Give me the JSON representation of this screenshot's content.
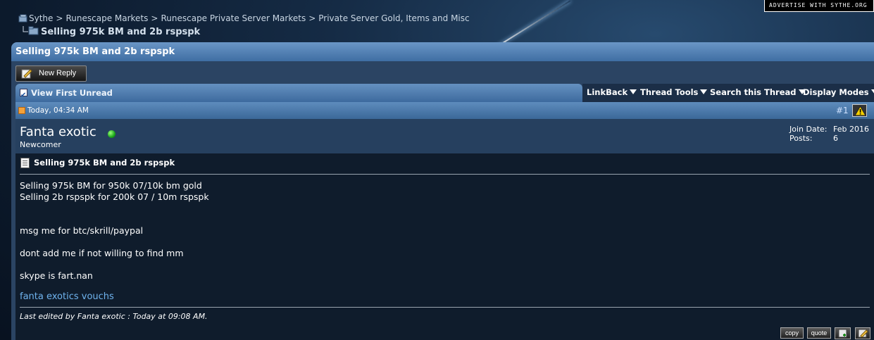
{
  "top": {
    "advertise": "ADVERTISE WITH SYTHE.ORG"
  },
  "breadcrumb": {
    "items": [
      "Sythe",
      "Runescape Markets",
      "Runescape Private Server Markets",
      "Private Server Gold, Items and Misc"
    ],
    "current": "Selling 975k BM and 2b rspspk"
  },
  "thread": {
    "title": "Selling 975k BM and 2b rspspk",
    "new_reply": "New Reply",
    "view_first_unread": "View First Unread",
    "menus": [
      "LinkBack",
      "Thread Tools",
      "Search this Thread",
      "Display Modes"
    ]
  },
  "post": {
    "date": "Today, 04:34 AM",
    "number": "#1",
    "username": "Fanta exotic",
    "usertitle": "Newcomer",
    "join_label": "Join Date:",
    "join_value": "Feb 2016",
    "posts_label": "Posts:",
    "posts_value": "6",
    "title": "Selling 975k BM and 2b rspspk",
    "lines": [
      "Selling 975k BM for 950k 07/10k bm gold",
      "Selling 2b rspspk for 200k 07 / 10m rspspk",
      "msg me for btc/skrill/paypal",
      "dont add me if not willing to find mm",
      "skype is fart.nan"
    ],
    "signature_link": "fanta exotics vouchs",
    "edited": "Last edited by Fanta exotic : Today at 09:08 AM.",
    "buttons": {
      "copy": "copy",
      "quote": "quote"
    }
  },
  "colors": {
    "link": "#6fb3ee",
    "online": "#1aa51a",
    "header_blue": "#4a78ab"
  }
}
